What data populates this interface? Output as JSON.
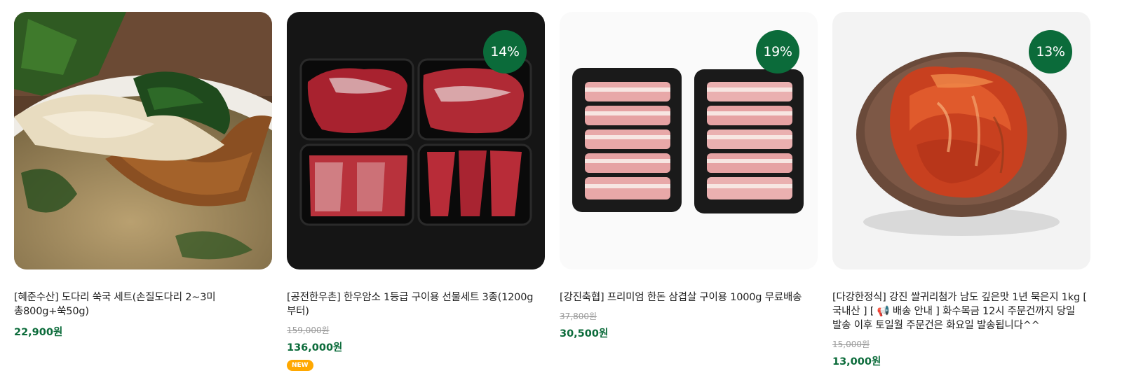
{
  "products": [
    {
      "title": "[혜준수산] 도다리 쑥국 세트(손질도다리 2~3미 총800g+쑥50g)",
      "original_price": "",
      "price": "22,900원",
      "discount": "",
      "tag": "",
      "image": "fish-soup-image"
    },
    {
      "title": "[공전한우촌] 한우암소 1등급 구이용 선물세트 3종(1200g 부터)",
      "original_price": "159,000원",
      "price": "136,000원",
      "discount": "14%",
      "tag": "NEW",
      "image": "hanwoo-beef-image"
    },
    {
      "title": "[강진축협] 프리미엄 한돈 삼겹살 구이용 1000g 무료배송",
      "original_price": "37,800원",
      "price": "30,500원",
      "discount": "19%",
      "tag": "",
      "image": "pork-belly-image"
    },
    {
      "title": "[다강한정식] 강진 쌀귀리첨가 남도 깊은맛 1년 묵은지 1kg [ 국내산 ] [ 📢 배송 안내 ] 화수목금 12시 주문건까지 당일 발송 이후 토일월 주문건은 화요일 발송됩니다^^",
      "original_price": "15,000원",
      "price": "13,000원",
      "discount": "13%",
      "tag": "",
      "image": "kimchi-image"
    }
  ],
  "colors": {
    "accent": "#0b6b3a",
    "new_tag": "#ffa800"
  }
}
